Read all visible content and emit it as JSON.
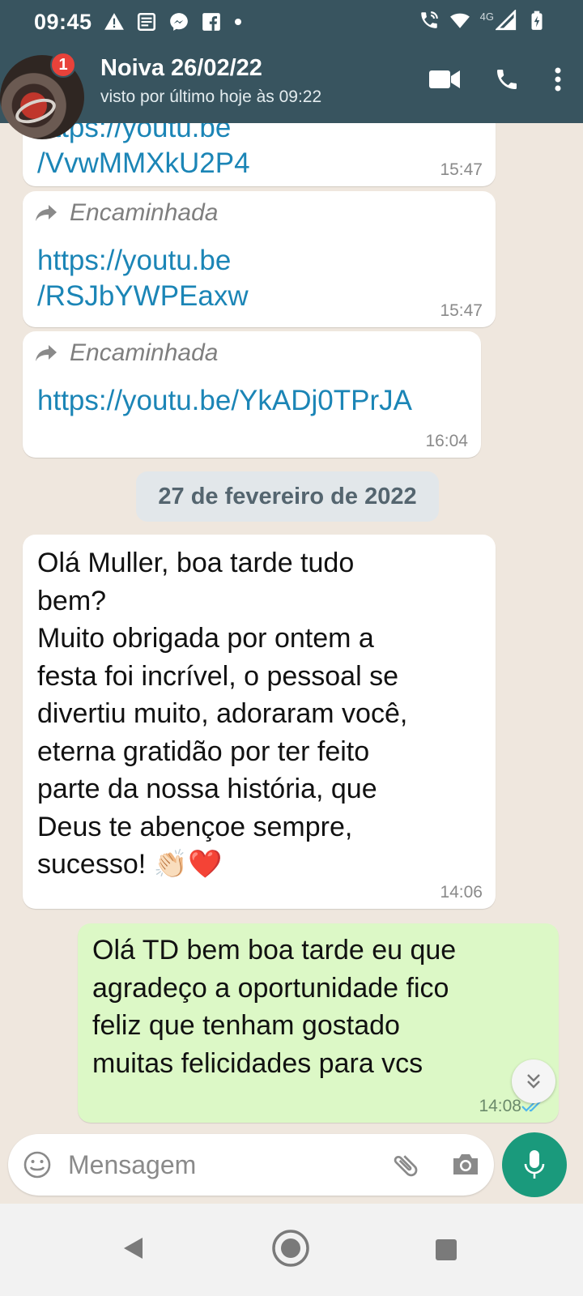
{
  "status_bar": {
    "time": "09:45",
    "network_label": "4G",
    "left_icons": [
      "alert-icon",
      "news-icon",
      "messenger-icon",
      "facebook-icon",
      "dot-icon"
    ],
    "right_icons": [
      "wifi-calling-icon",
      "wifi-icon",
      "signal-icon",
      "battery-charging-icon"
    ]
  },
  "header": {
    "contact_name": "Noiva 26/02/22",
    "last_seen": "visto por último hoje às 09:22",
    "unread_badge": "1",
    "actions": [
      "video-call-icon",
      "phone-call-icon",
      "more-vert-icon"
    ]
  },
  "messages": [
    {
      "direction": "in",
      "link_lines": [
        "https://youtu.be",
        "/VvwMMXkU2P4"
      ],
      "time": "15:47"
    },
    {
      "direction": "in",
      "forwarded_label": "Encaminhada",
      "link_lines": [
        "https://youtu.be",
        "/RSJbYWPEaxw"
      ],
      "time": "15:47"
    },
    {
      "direction": "in",
      "forwarded_label": "Encaminhada",
      "link_lines": [
        "https://youtu.be/YkADj0TPrJA"
      ],
      "time": "16:04"
    },
    {
      "direction": "in",
      "text_lines": [
        "Olá Muller, boa tarde tudo",
        "bem?",
        "Muito obrigada por ontem a",
        "festa foi incrível, o pessoal se",
        "divertiu muito, adoraram você,",
        "eterna gratidão por ter feito",
        "parte da nossa história, que",
        "Deus te abençoe sempre,",
        "sucesso! 👏🏻❤️"
      ],
      "time": "14:06"
    },
    {
      "direction": "out",
      "text_lines": [
        "Olá TD bem boa tarde eu que",
        "agradeço a oportunidade fico",
        "feliz que tenham gostado",
        "muitas felicidades para vcs"
      ],
      "time": "14:08",
      "read_status": "read"
    }
  ],
  "date_separator": "27 de fevereiro de 2022",
  "composer": {
    "placeholder": "Mensagem"
  },
  "colors": {
    "header_bg": "#38545f",
    "chat_bg": "#efe7de",
    "outgoing_bubble": "#dcf8c6",
    "link": "#1b85b6",
    "mic_button": "#1a9a7c",
    "read_ticks": "#4fb6ec",
    "badge": "#e8423a"
  }
}
